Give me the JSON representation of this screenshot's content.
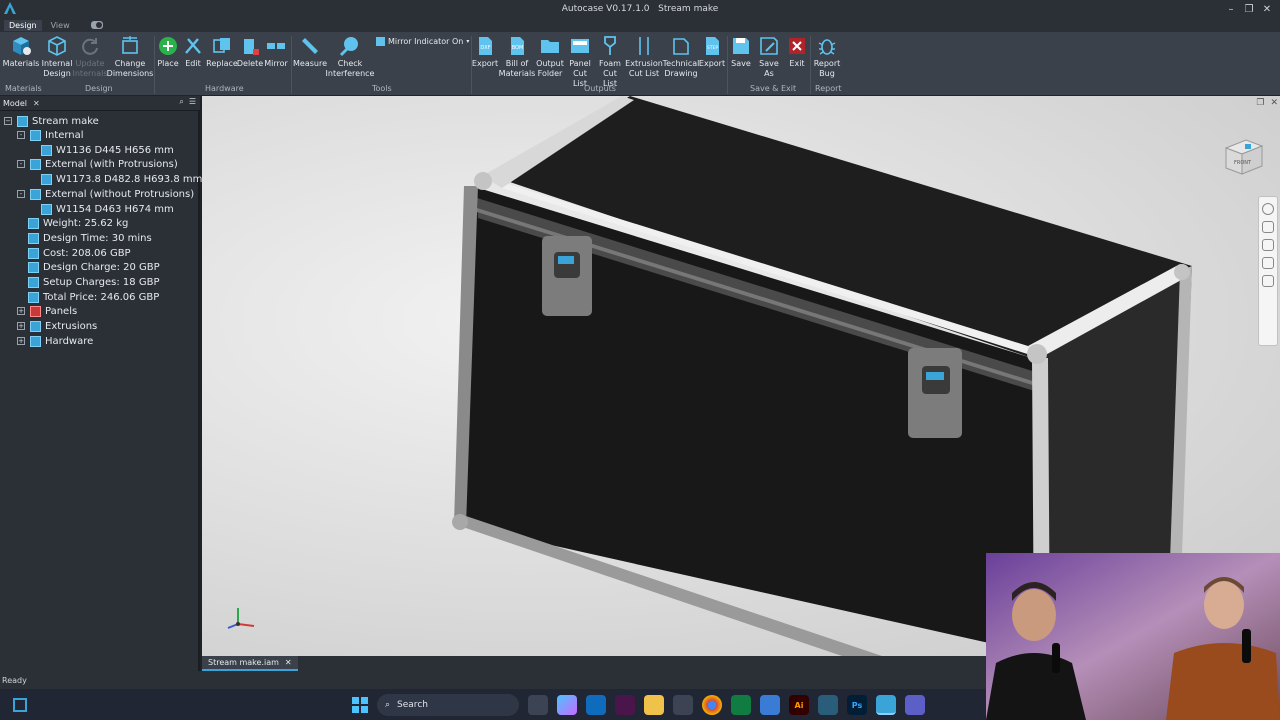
{
  "app": {
    "title": "Autocase V0.17.1.0",
    "document": "Stream make"
  },
  "ribbon_tabs": [
    {
      "label": "Design",
      "active": true
    },
    {
      "label": "View",
      "active": false
    }
  ],
  "ribbon": {
    "buttons": [
      {
        "key": "materials",
        "label": "Materials",
        "icon": "materials-icon"
      },
      {
        "key": "internal_design",
        "label": "Internal Design",
        "icon": "cube-icon"
      },
      {
        "key": "update_internals",
        "label": "Update Internals",
        "icon": "refresh-icon",
        "disabled": true
      },
      {
        "key": "change_dimensions",
        "label": "Change Dimensions",
        "icon": "dimensions-icon"
      },
      {
        "key": "place",
        "label": "Place",
        "icon": "plus-circle-icon"
      },
      {
        "key": "edit",
        "label": "Edit",
        "icon": "edit-icon"
      },
      {
        "key": "replace",
        "label": "Replace",
        "icon": "replace-icon"
      },
      {
        "key": "delete",
        "label": "Delete",
        "icon": "delete-icon"
      },
      {
        "key": "mirror",
        "label": "Mirror",
        "icon": "mirror-icon"
      },
      {
        "key": "measure",
        "label": "Measure",
        "icon": "ruler-icon"
      },
      {
        "key": "check_interference",
        "label": "Check Interference",
        "icon": "interference-icon"
      },
      {
        "key": "export_dxf",
        "label": "Export",
        "icon": "dxf-icon"
      },
      {
        "key": "bill_of_materials",
        "label": "Bill of Materials",
        "icon": "bom-icon"
      },
      {
        "key": "output_folder",
        "label": "Output Folder",
        "icon": "folder-icon"
      },
      {
        "key": "panel_cut_list",
        "label": "Panel Cut List",
        "icon": "panel-icon"
      },
      {
        "key": "foam_cut_list",
        "label": "Foam Cut List",
        "icon": "foam-icon"
      },
      {
        "key": "extrusion_cut_list",
        "label": "Extrusion Cut List",
        "icon": "extrusion-icon"
      },
      {
        "key": "technical_drawing",
        "label": "Technical Drawing",
        "icon": "drawing-icon"
      },
      {
        "key": "export_step",
        "label": "Export",
        "icon": "step-icon"
      },
      {
        "key": "save",
        "label": "Save",
        "icon": "save-icon"
      },
      {
        "key": "save_as",
        "label": "Save As",
        "icon": "save-as-icon"
      },
      {
        "key": "exit",
        "label": "Exit",
        "icon": "exit-icon"
      },
      {
        "key": "report_bug",
        "label": "Report Bug",
        "icon": "bug-icon"
      }
    ],
    "mirror_indicator": "Mirror Indicator On",
    "groups": [
      "Materials",
      "Design",
      "Hardware",
      "Tools",
      "Outputs",
      "Save & Exit",
      "Report"
    ],
    "icon_badges": {
      "dxf": "DXF",
      "bom": "BOM",
      "step": "STEP"
    }
  },
  "panel": {
    "title": "Model"
  },
  "tree": [
    {
      "label": "Stream make",
      "level": 0,
      "expander": ""
    },
    {
      "label": "Internal",
      "level": 1,
      "expander": "-"
    },
    {
      "label": "W1136 D445 H656 mm",
      "level": 2,
      "expander": ""
    },
    {
      "label": "External (with Protrusions)",
      "level": 1,
      "expander": "-"
    },
    {
      "label": "W1173.8 D482.8 H693.8 mm",
      "level": 2,
      "expander": ""
    },
    {
      "label": "External (without Protrusions)",
      "level": 1,
      "expander": "-"
    },
    {
      "label": "W1154 D463 H674 mm",
      "level": 2,
      "expander": ""
    },
    {
      "label": "Weight: 25.62 kg",
      "level": 1,
      "expander": ""
    },
    {
      "label": "Design Time: 30 mins",
      "level": 1,
      "expander": ""
    },
    {
      "label": "Cost: 208.06 GBP",
      "level": 1,
      "expander": ""
    },
    {
      "label": "Design Charge: 20 GBP",
      "level": 1,
      "expander": ""
    },
    {
      "label": "Setup Charges: 18 GBP",
      "level": 1,
      "expander": ""
    },
    {
      "label": "Total Price: 246.06 GBP",
      "level": 1,
      "expander": ""
    },
    {
      "label": "Panels",
      "level": 1,
      "expander": "+"
    },
    {
      "label": "Extrusions",
      "level": 1,
      "expander": "+"
    },
    {
      "label": "Hardware",
      "level": 1,
      "expander": "+"
    }
  ],
  "viewcube": {
    "face": "FRONT"
  },
  "doc_tab": {
    "label": "Stream make.iam"
  },
  "status": {
    "text": "Ready"
  },
  "taskbar": {
    "search_label": "Search",
    "apps": [
      "file-explorer-icon",
      "copilot-icon",
      "outlook-icon",
      "slack-icon",
      "folder-icon",
      "store-icon",
      "chrome-icon",
      "excel-icon",
      "vpn-icon",
      "illustrator-icon",
      "inventor-icon",
      "photoshop-icon",
      "autocase-icon",
      "teams-icon"
    ],
    "badges": {
      "illustrator": "Ai",
      "photoshop": "Ps"
    }
  },
  "colors": {
    "accent": "#3aa4d8",
    "ribbon": "#3a414a",
    "panel": "#2b3037"
  }
}
